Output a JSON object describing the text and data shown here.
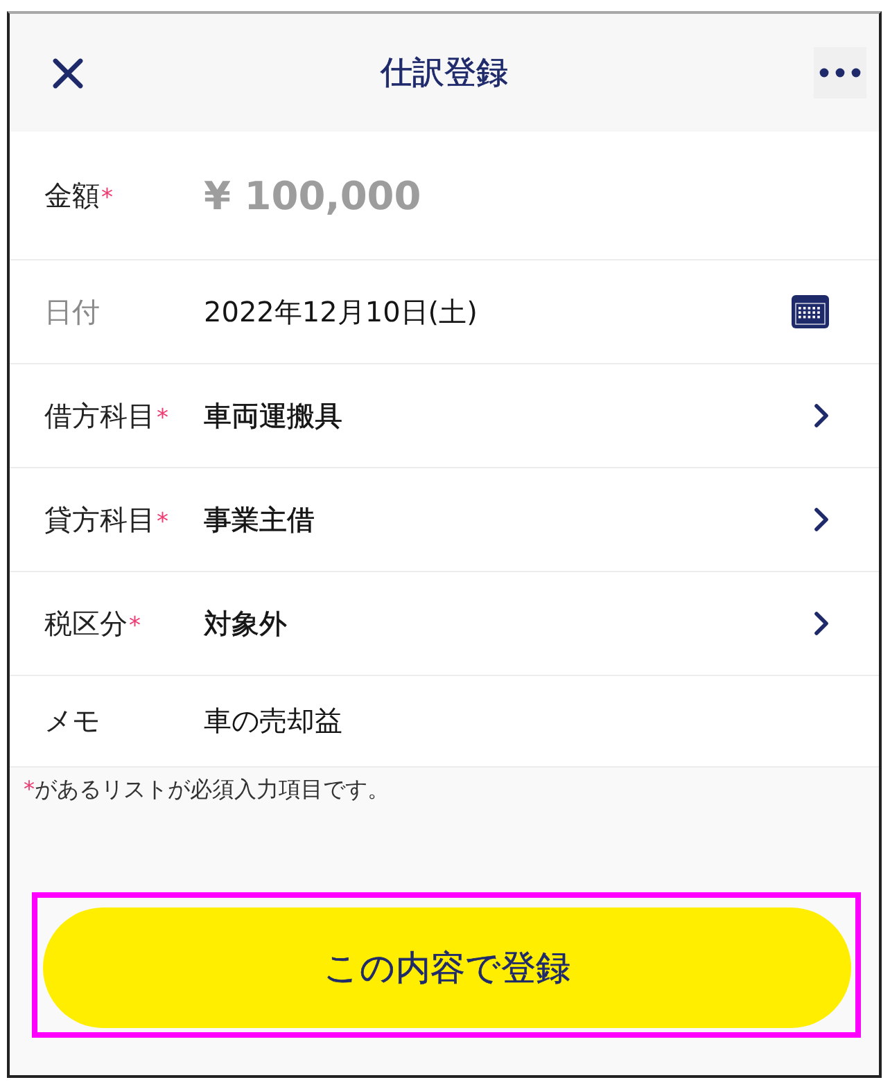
{
  "header": {
    "title": "仕訳登録"
  },
  "rows": [
    {
      "kind": "amount",
      "label": "金額",
      "required_mark": "*",
      "value": "¥ 100,000"
    },
    {
      "kind": "date",
      "label": "日付",
      "value": "2022年12月10日(土)"
    },
    {
      "kind": "select",
      "label": "借方科目",
      "required_mark": "*",
      "value": "車両運搬具"
    },
    {
      "kind": "select",
      "label": "貸方科目",
      "required_mark": "*",
      "value": "事業主借"
    },
    {
      "kind": "select",
      "label": "税区分",
      "required_mark": "*",
      "value": "対象外"
    },
    {
      "kind": "text",
      "label": "メモ",
      "value": "車の売却益"
    }
  ],
  "note": {
    "mark": "*",
    "text": "があるリストが必須入力項目です。"
  },
  "submit": {
    "label": "この内容で登録",
    "highlighted": true
  }
}
